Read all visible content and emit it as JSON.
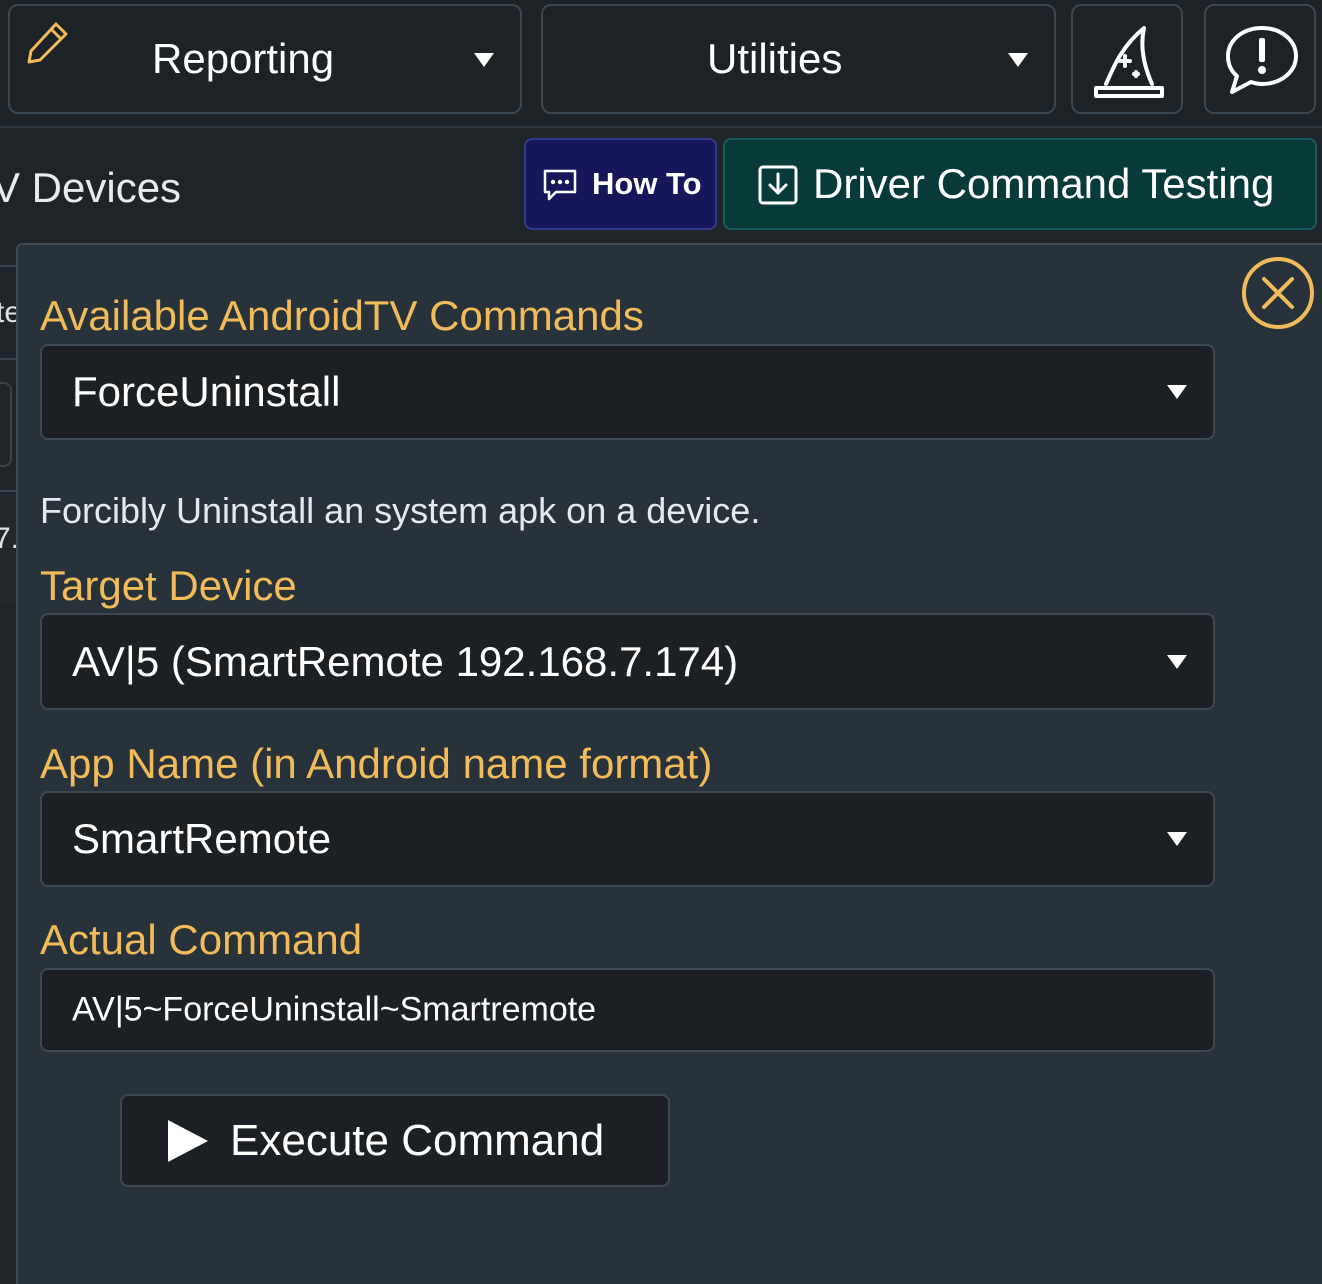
{
  "topbar": {
    "reporting_label": "Reporting",
    "utilities_label": "Utilities",
    "icons": [
      "pencil-icon",
      "wizard-hat-icon",
      "alert-bubble-icon"
    ]
  },
  "subheader": {
    "title": "V Devices",
    "howto_label": "How To",
    "driver_testing_label": "Driver Command Testing"
  },
  "background_fragments": {
    "text1": "te",
    "text2": "7."
  },
  "panel": {
    "commands_label": "Available AndroidTV Commands",
    "command_value": "ForceUninstall",
    "description": "Forcibly Uninstall an system apk on a device.",
    "target_label": "Target Device",
    "target_value": "AV|5 (SmartRemote 192.168.7.174)",
    "app_label": "App Name (in Android name format)",
    "app_value": "SmartRemote",
    "actual_label": "Actual Command",
    "actual_value": "AV|5~ForceUninstall~Smartremote",
    "execute_label": "Execute Command"
  },
  "colors": {
    "accent_label": "#f1bb5a",
    "howto_bg": "#16175a",
    "driver_testing_bg": "#083a3a",
    "panel_bg": "#28323a"
  }
}
